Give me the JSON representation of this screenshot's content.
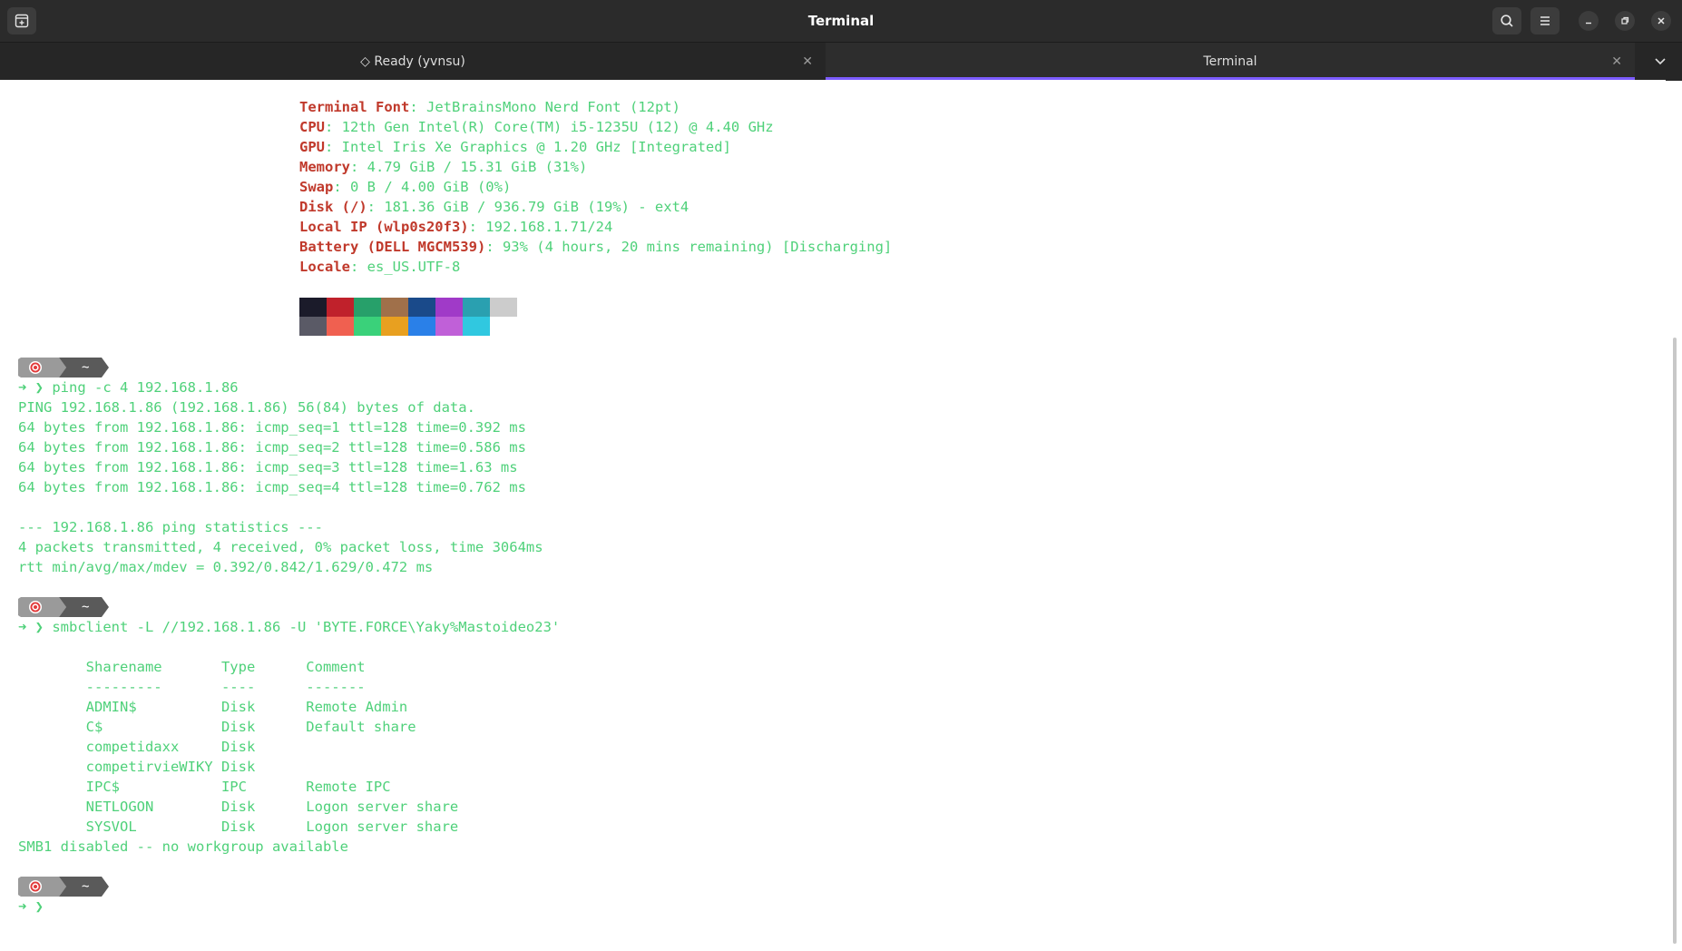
{
  "window": {
    "title": "Terminal"
  },
  "tabs": [
    {
      "label": "◇ Ready (yvnsu)"
    },
    {
      "label": "Terminal"
    }
  ],
  "sysinfo": [
    {
      "label": "Terminal Font",
      "value": ": JetBrainsMono Nerd Font (12pt)"
    },
    {
      "label": "CPU",
      "value": ": 12th Gen Intel(R) Core(TM) i5-1235U (12) @ 4.40 GHz"
    },
    {
      "label": "GPU",
      "value": ": Intel Iris Xe Graphics @ 1.20 GHz [Integrated]"
    },
    {
      "label": "Memory",
      "value": ": 4.79 GiB / 15.31 GiB (31%)"
    },
    {
      "label": "Swap",
      "value": ": 0 B / 4.00 GiB (0%)"
    },
    {
      "label": "Disk (/)",
      "value": ": 181.36 GiB / 936.79 GiB (19%) - ext4"
    },
    {
      "label": "Local IP (wlp0s20f3)",
      "value": ": 192.168.1.71/24"
    },
    {
      "label": "Battery (DELL MGCM539)",
      "value": ": 93% (4 hours, 20 mins remaining) [Discharging]"
    },
    {
      "label": "Locale",
      "value": ": es_US.UTF-8"
    }
  ],
  "palette": {
    "row1": [
      "#1b1b2a",
      "#c0212b",
      "#27a06a",
      "#a0704a",
      "#1a4a8a",
      "#a03ac8",
      "#2aa0b0",
      "#cccccc"
    ],
    "row2": [
      "#5a5a66",
      "#f06050",
      "#3ad17a",
      "#e8a020",
      "#2a80e8",
      "#c060d8",
      "#30c8e0"
    ]
  },
  "prompt": {
    "badge_dir": "~",
    "badge_icon": "target-icon"
  },
  "lines": {
    "cmd1": "➜ ❯ ping -c 4 192.168.1.86",
    "ping_header": "PING 192.168.1.86 (192.168.1.86) 56(84) bytes of data.",
    "ping1": "64 bytes from 192.168.1.86: icmp_seq=1 ttl=128 time=0.392 ms",
    "ping2": "64 bytes from 192.168.1.86: icmp_seq=2 ttl=128 time=0.586 ms",
    "ping3": "64 bytes from 192.168.1.86: icmp_seq=3 ttl=128 time=1.63 ms",
    "ping4": "64 bytes from 192.168.1.86: icmp_seq=4 ttl=128 time=0.762 ms",
    "stats_header": "--- 192.168.1.86 ping statistics ---",
    "stats1": "4 packets transmitted, 4 received, 0% packet loss, time 3064ms",
    "stats2": "rtt min/avg/max/mdev = 0.392/0.842/1.629/0.472 ms",
    "cmd2": "➜ ❯ smbclient -L //192.168.1.86 -U 'BYTE.FORCE\\Yaky%Mastoideo23'",
    "smb_header": "        Sharename       Type      Comment",
    "smb_sep": "        ---------       ----      -------",
    "smb1": "        ADMIN$          Disk      Remote Admin",
    "smb2": "        C$              Disk      Default share",
    "smb3": "        competidaxx     Disk",
    "smb4": "        competirvieWIKY Disk",
    "smb5": "        IPC$            IPC       Remote IPC",
    "smb6": "        NETLOGON        Disk      Logon server share",
    "smb7": "        SYSVOL          Disk      Logon server share",
    "smb_footer": "SMB1 disabled -- no workgroup available",
    "cmd3": "➜ ❯"
  }
}
